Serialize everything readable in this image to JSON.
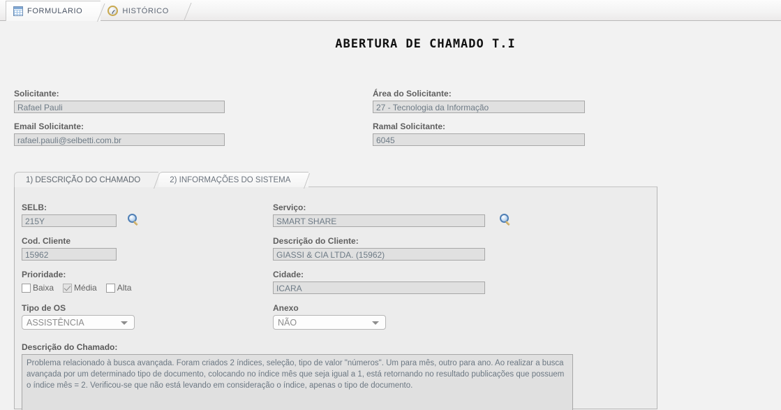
{
  "window": {
    "tabs": [
      {
        "label": "FORMULARIO",
        "icon": "grid-icon",
        "active": true
      },
      {
        "label": "HISTÓRICO",
        "icon": "clock-icon",
        "active": false
      }
    ]
  },
  "page_title": "ABERTURA DE CHAMADO T.I",
  "header_fields": {
    "solicitante": {
      "label": "Solicitante:",
      "value": "Rafael Pauli"
    },
    "area": {
      "label": "Área do Solicitante:",
      "value": "27 - Tecnologia da Informação"
    },
    "email": {
      "label": "Email Solicitante:",
      "value": "rafael.pauli@selbetti.com.br"
    },
    "ramal": {
      "label": "Ramal Solicitante:",
      "value": "6045"
    }
  },
  "panel": {
    "tabs": [
      {
        "label": "1) DESCRIÇÃO DO CHAMADO",
        "active": true
      },
      {
        "label": "2) INFORMAÇÕES DO SISTEMA",
        "active": false
      }
    ],
    "fields": {
      "selb": {
        "label": "SELB:",
        "value": "215Y"
      },
      "servico": {
        "label": "Serviço:",
        "value": "SMART SHARE"
      },
      "cod_cliente": {
        "label": "Cod. Cliente",
        "value": "15962"
      },
      "descricao_cliente": {
        "label": "Descrição do Cliente:",
        "value": "GIASSI & CIA LTDA. (15962)"
      },
      "prioridade": {
        "label": "Prioridade:",
        "options": [
          {
            "label": "Baixa",
            "checked": false
          },
          {
            "label": "Média",
            "checked": true
          },
          {
            "label": "Alta",
            "checked": false
          }
        ]
      },
      "cidade": {
        "label": "Cidade:",
        "value": "ICARA"
      },
      "tipo_os": {
        "label": "Tipo de OS",
        "value": "ASSISTÊNCIA"
      },
      "anexo": {
        "label": "Anexo",
        "value": "NÃO"
      },
      "descricao_chamado": {
        "label": "Descrição do Chamado:",
        "value": "Problema relacionado à busca avançada. Foram criados 2 índices, seleção, tipo de valor \"números\". Um para mês, outro para ano. Ao realizar a busca avançada por um determinado tipo de documento, colocando no índice mês que seja igual a 1, está retornando no resultado publicações que possuem o índice mês = 2. Verificou-se que não está levando em consideração o índice, apenas o tipo de documento."
      }
    }
  },
  "colors": {
    "page_background": "#f2f2f2",
    "panel_background": "#ececec",
    "input_background": "#e0e0e0",
    "input_border": "#a7a7a7",
    "input_text": "#6e7b86",
    "label_text": "#5f5f5f",
    "tab_text": "#6b737d"
  }
}
